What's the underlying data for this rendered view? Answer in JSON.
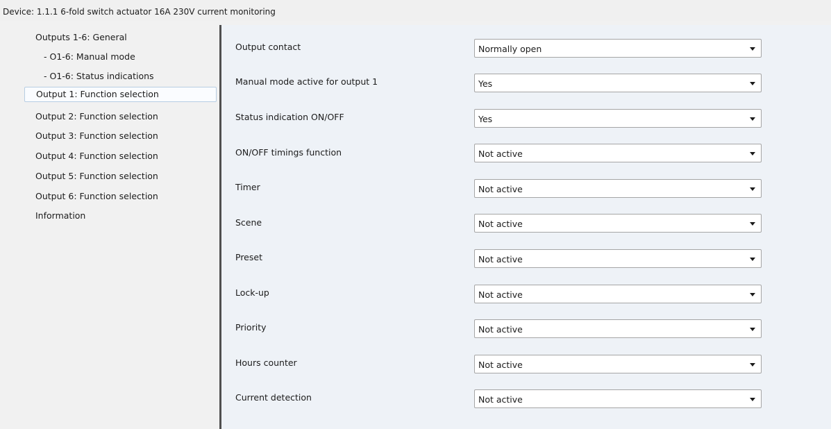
{
  "window": {
    "title": "Device: 1.1.1  6-fold switch actuator 16A 230V current monitoring"
  },
  "sidebar": {
    "items": [
      {
        "label": "Outputs 1-6: General"
      },
      {
        "label": "- O1-6: Manual mode"
      },
      {
        "label": "- O1-6: Status indications"
      },
      {
        "label": "Output 1: Function selection",
        "selected": true
      },
      {
        "label": "Output 2: Function selection"
      },
      {
        "label": "Output 3: Function selection"
      },
      {
        "label": "Output 4: Function selection"
      },
      {
        "label": "Output 5: Function selection"
      },
      {
        "label": "Output 6: Function selection"
      },
      {
        "label": "Information"
      }
    ]
  },
  "params": [
    {
      "label": "Output contact",
      "value": "Normally open"
    },
    {
      "label": "Manual mode active for output 1",
      "value": "Yes"
    },
    {
      "label": "Status indication ON/OFF",
      "value": "Yes"
    },
    {
      "label": "ON/OFF timings function",
      "value": "Not active"
    },
    {
      "label": "Timer",
      "value": "Not active"
    },
    {
      "label": "Scene",
      "value": "Not active"
    },
    {
      "label": "Preset",
      "value": "Not active"
    },
    {
      "label": "Lock-up",
      "value": "Not active"
    },
    {
      "label": "Priority",
      "value": "Not active"
    },
    {
      "label": "Hours counter",
      "value": "Not active"
    },
    {
      "label": "Current detection",
      "value": "Not active"
    }
  ]
}
